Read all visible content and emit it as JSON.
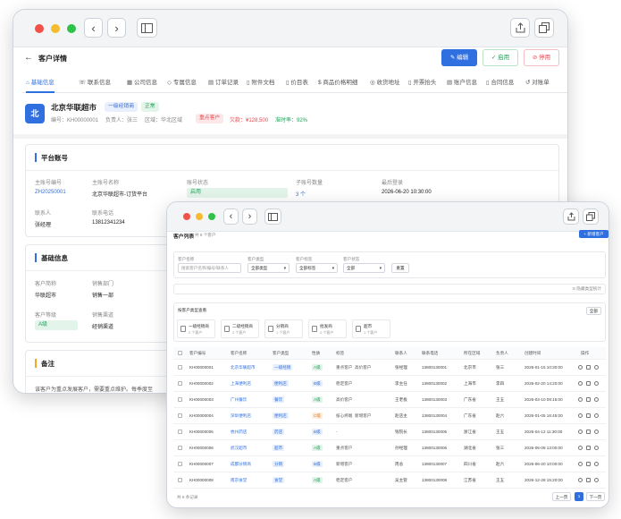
{
  "back_window": {
    "page_title": "客户详情",
    "actions": {
      "edit": "编辑",
      "enable": "启用",
      "disable": "停用"
    },
    "tabs": [
      "基础信息",
      "联系信息",
      "公司信息",
      "专属信息",
      "订单记录",
      "附件文档",
      "价目表",
      "商品价格明细",
      "收货地址",
      "开票抬头",
      "账户信息",
      "合同信息",
      "对账单"
    ],
    "customer": {
      "avatar": "北",
      "name": "北京华联超市",
      "level_tag": "一级经销商",
      "status_tag": "正常",
      "code_text": "编号：KH00000001",
      "owner_text": "负责人：张三",
      "region_text": "区域：华北区域",
      "key_tag": "重点客户",
      "arrears_text": "欠款：¥128,500",
      "ontime_text": "准时率：92%"
    },
    "platform": {
      "title": "平台账号",
      "fields": [
        {
          "label": "主账号编号",
          "value": "ZH20250001"
        },
        {
          "label": "主账号名称",
          "value": "北京华联超市-订货平台"
        },
        {
          "label": "账号状态",
          "value": "启用"
        },
        {
          "label": "子账号数量",
          "value": "3 个"
        },
        {
          "label": "最后登录",
          "value": "2026-06-20 10:30:00"
        },
        {
          "label": "联系人",
          "value": "张经理"
        },
        {
          "label": "联系电话",
          "value": "13812341234"
        }
      ]
    },
    "basic": {
      "title": "基础信息",
      "fields": [
        {
          "label": "客户简称",
          "value": "华联超市"
        },
        {
          "label": "销售部门",
          "value": "销售一部"
        },
        {
          "label": "客户等级",
          "value": "A级"
        },
        {
          "label": "销售渠道",
          "value": "经销渠道"
        }
      ]
    },
    "remark": {
      "title": "备注",
      "text": "该客户为重点发展客户，需要重点维护。每季度至"
    }
  },
  "front_window": {
    "title": "客户列表",
    "subtitle": "共 8 个客户",
    "add_button": "+ 新增客户",
    "filters": {
      "name_label": "客户名称",
      "name_placeholder": "搜索客户名称/编号/联系人",
      "type_label": "客户类型",
      "type_value": "全部类型",
      "tag_label": "客户标签",
      "tag_value": "全部标签",
      "status_label": "客户状态",
      "status_value": "全部",
      "reset": "重置"
    },
    "hide_stats": "⊙ 隐藏类型统计",
    "stats": {
      "title": "按客户类型查看",
      "all": "全部",
      "cards": [
        {
          "name": "一级经销商",
          "count": "2 个客户"
        },
        {
          "name": "二级经销商",
          "count": "2 个客户"
        },
        {
          "name": "分销商",
          "count": "1 个客户"
        },
        {
          "name": "批发商",
          "count": "2 个客户"
        },
        {
          "name": "超市",
          "count": "1 个客户"
        }
      ]
    },
    "table": {
      "headers": [
        "客户编号",
        "客户名称",
        "客户类型",
        "性质",
        "标签",
        "联系人",
        "联系电话",
        "所在区域",
        "负责人",
        "创建时间",
        "操作"
      ],
      "rows": [
        {
          "code": "KH00000001",
          "name": "北京华联超市",
          "type": "一级经销",
          "grade": "A级",
          "tags": [
            "重点客户",
            "高价客户"
          ],
          "contact": "张经理",
          "phone": "13800130001",
          "region": "北京市",
          "owner": "张三",
          "created": "2026-01-15 10:30:00"
        },
        {
          "code": "KH00000002",
          "name": "上海便利店",
          "type": "便利店",
          "grade": "B级",
          "tags": [
            "稳定客户"
          ],
          "contact": "李主任",
          "phone": "13800130002",
          "region": "上海市",
          "owner": "李四",
          "created": "2026-02-20 14:20:00"
        },
        {
          "code": "KH00000003",
          "name": "广州餐饮",
          "type": "餐饮",
          "grade": "A级",
          "tags": [
            "高价客户"
          ],
          "contact": "王老板",
          "phone": "13800130003",
          "region": "广东省",
          "owner": "王五",
          "created": "2026-03-10 09:15:00"
        },
        {
          "code": "KH00000004",
          "name": "深圳便利店",
          "type": "便利店",
          "grade": "C级",
          "tags": [
            "核心终端",
            "新增客户"
          ],
          "contact": "赵店主",
          "phone": "13800130004",
          "region": "广东省",
          "owner": "赵六",
          "created": "2026-01-05 16:45:00"
        },
        {
          "code": "KH00000005",
          "name": "杭州药店",
          "type": "药店",
          "grade": "B级",
          "tags": [
            "-"
          ],
          "contact": "钱院长",
          "phone": "13800130005",
          "region": "浙江省",
          "owner": "王五",
          "created": "2026-04-12 11:30:00"
        },
        {
          "code": "KH00000006",
          "name": "武汉超市",
          "type": "超市",
          "grade": "A级",
          "tags": [
            "重点客户"
          ],
          "contact": "孙经理",
          "phone": "13800130006",
          "region": "湖北省",
          "owner": "张三",
          "created": "2026-05-08 13:00:00"
        },
        {
          "code": "KH00000007",
          "name": "成都分销商",
          "type": "分销",
          "grade": "B级",
          "tags": [
            "新增客户"
          ],
          "contact": "周总",
          "phone": "13800130007",
          "region": "四川省",
          "owner": "赵六",
          "created": "2026-06-20 10:00:00"
        },
        {
          "code": "KH00000008",
          "name": "南京食堂",
          "type": "食堂",
          "grade": "A级",
          "tags": [
            "稳定客户"
          ],
          "contact": "吴主管",
          "phone": "13800130008",
          "region": "江苏省",
          "owner": "王五",
          "created": "2026-12-28 15:20:00"
        }
      ]
    },
    "footer": {
      "total": "共 8 条记录",
      "prev": "上一页",
      "page": "1",
      "next": "下一页"
    }
  },
  "colors": {
    "accent": "#2f6fdf",
    "danger": "#e5484d",
    "success": "#22a05a"
  }
}
